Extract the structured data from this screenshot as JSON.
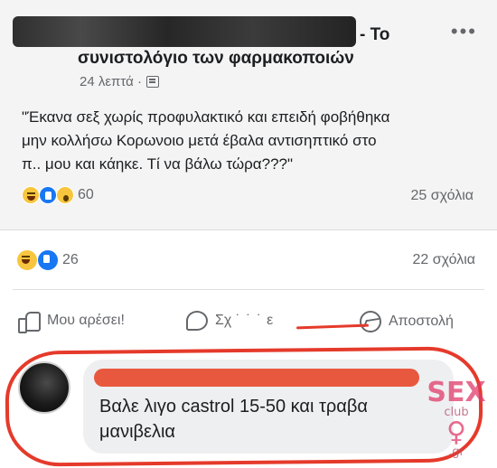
{
  "shared_post": {
    "header_to": "- Το",
    "group_name": "συνιστολόγιο των φαρμακοποιών",
    "time": "24 λεπτά ·",
    "body_line1": "\"Έκανα σεξ χωρίς προφυλακτικό και επειδή φοβήθηκα",
    "body_line2": "μην κολλήσω Κορωνοιο μετά έβαλα αντισηπτικό στο",
    "body_line3": "π.. μου και κάηκε. Τί να βάλω τώρα???\"",
    "reactions_count": "60",
    "comments": "25 σχόλια",
    "more_icon": "more-dots-icon"
  },
  "post": {
    "reactions_count": "26",
    "comments": "22 σχόλια"
  },
  "actions": {
    "like": "Μου αρέσει!",
    "comment_prefix": "Σχ",
    "comment_garble": "˙ ˙ ˙",
    "comment_suffix": "ε",
    "send": "Αποστολή"
  },
  "comment": {
    "text_line1": "Βαλε λιγο castrol 15-50 και τραβα",
    "text_line2": "μανιβελια"
  },
  "watermark": {
    "word": "SEX",
    "sub": "club",
    "domain": ".gr"
  },
  "colors": {
    "highlight": "#e53a2b",
    "like_blue": "#1877f2",
    "haha_yellow": "#f7c63e"
  }
}
